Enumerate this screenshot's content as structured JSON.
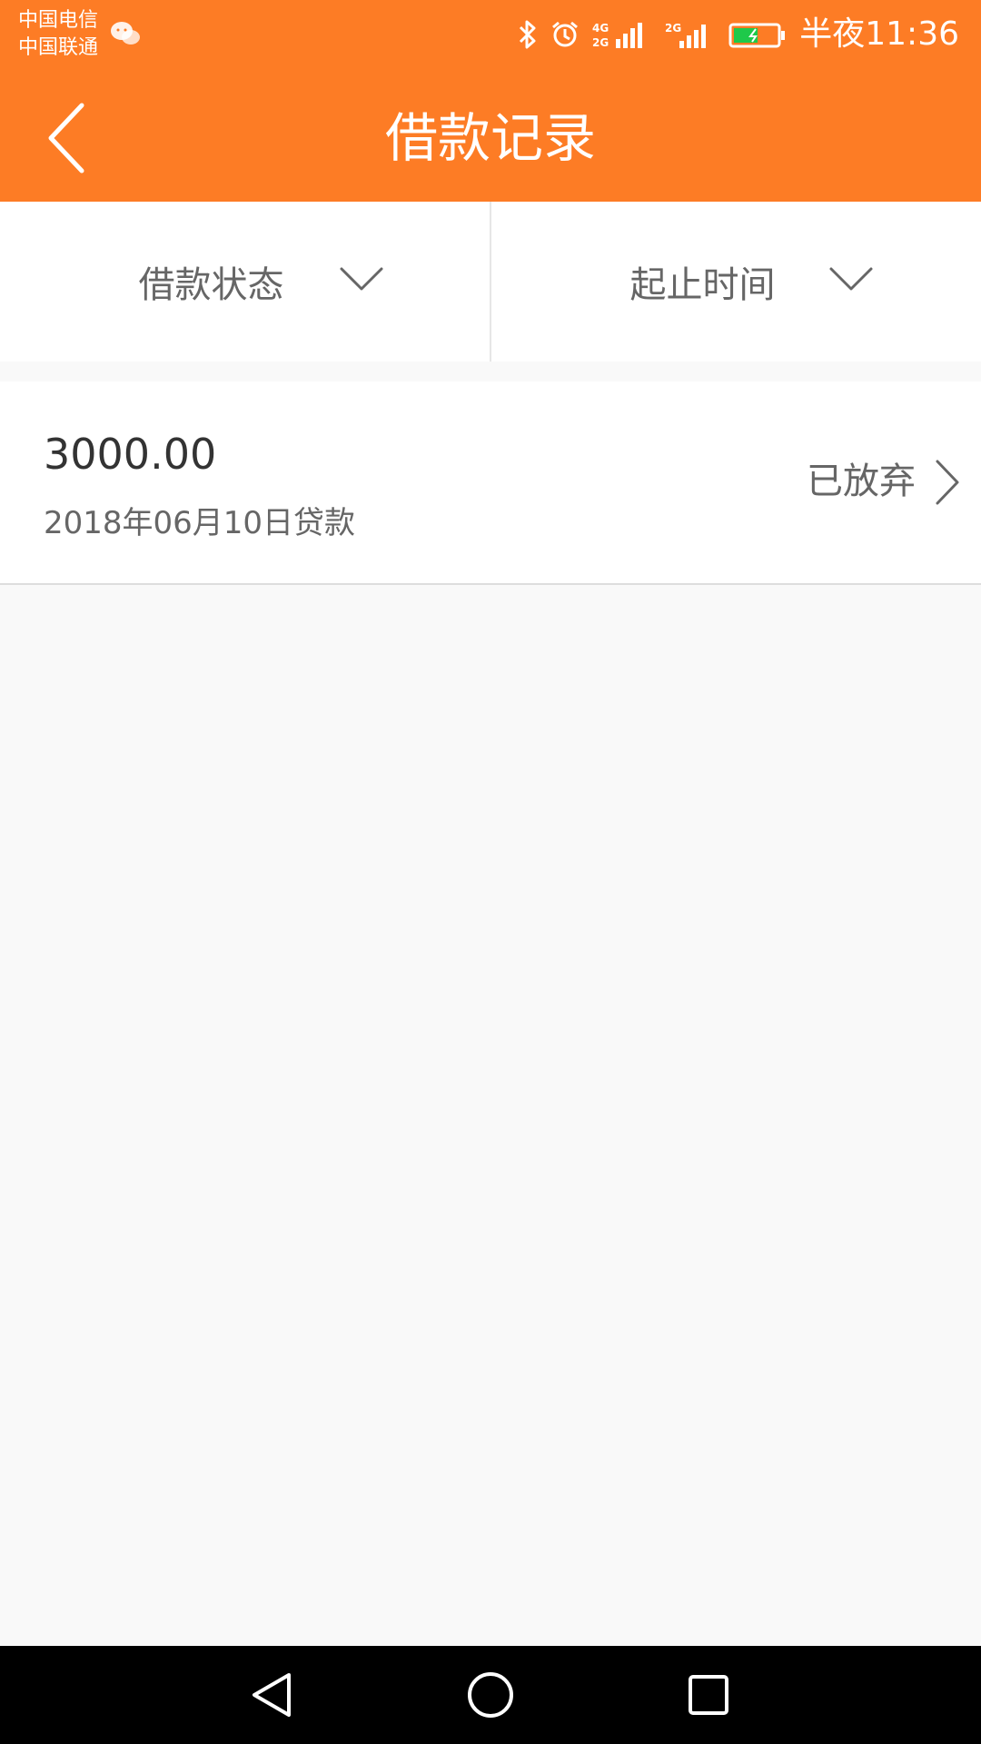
{
  "status_bar": {
    "carrier_1": "中国电信",
    "carrier_2": "中国联通",
    "network_1": "4G",
    "network_2": "2G",
    "network_3": "2G",
    "time": "半夜11:36",
    "icons": [
      "wechat-icon",
      "bluetooth-icon",
      "alarm-icon",
      "signal-icon",
      "battery-icon"
    ]
  },
  "app_bar": {
    "title": "借款记录",
    "back_icon": "chevron-left-icon",
    "color": "#fd7c25"
  },
  "filters": [
    {
      "label": "借款状态",
      "icon": "chevron-down-icon"
    },
    {
      "label": "起止时间",
      "icon": "chevron-down-icon"
    }
  ],
  "records": [
    {
      "amount": "3000.00",
      "date": "2018年06月10日贷款",
      "status": "已放弃",
      "icon": "chevron-right-icon"
    }
  ],
  "nav_bar": {
    "icons": [
      "nav-back-icon",
      "nav-home-icon",
      "nav-recent-icon"
    ]
  }
}
